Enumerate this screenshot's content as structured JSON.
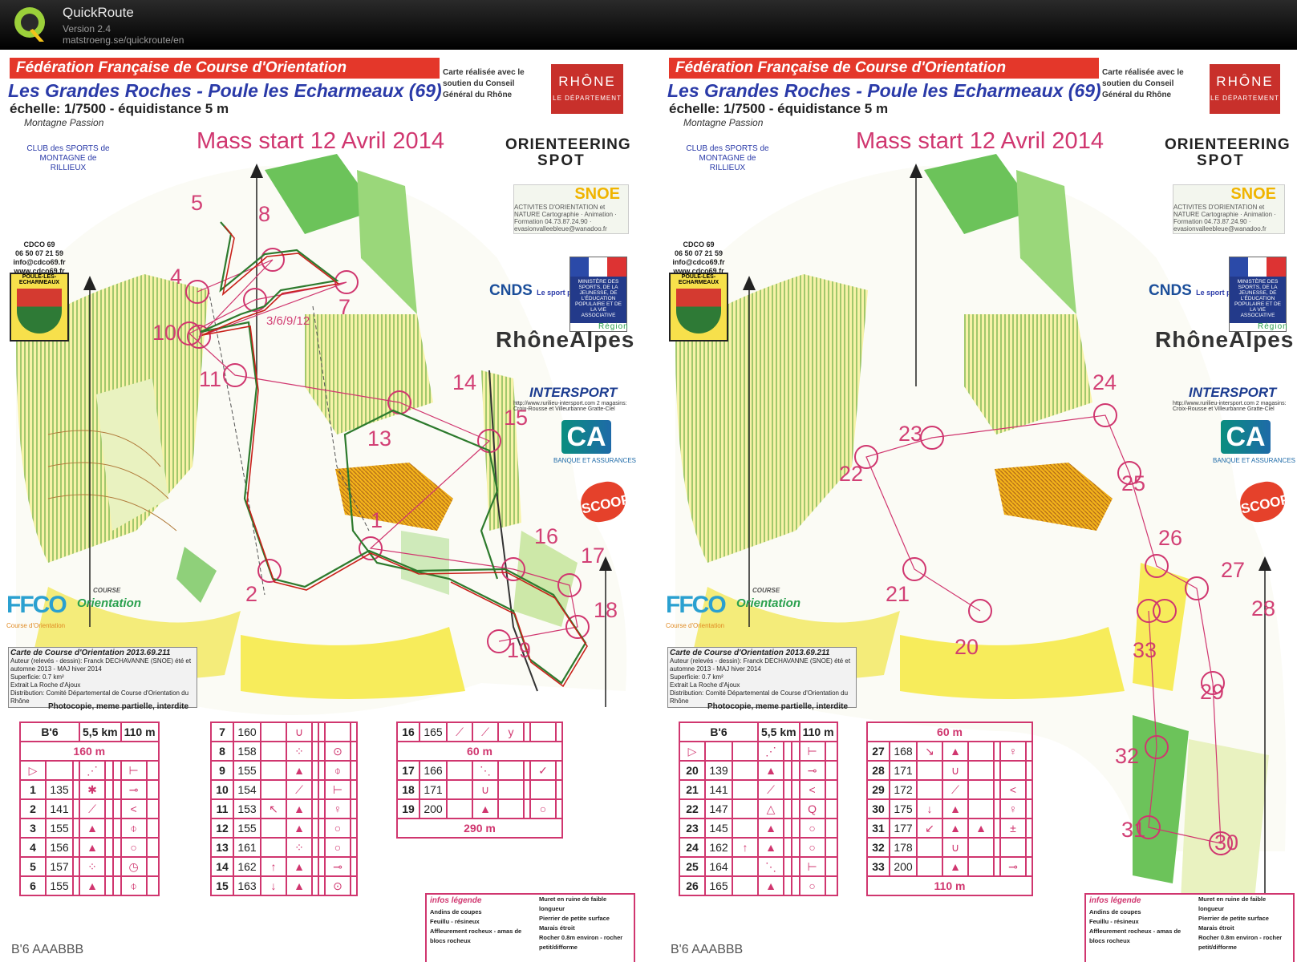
{
  "app": {
    "title": "QuickRoute",
    "version": "Version 2.4",
    "url": "matstroeng.se/quickroute/en"
  },
  "map": {
    "federation": "Fédération Française de Course d'Orientation",
    "event_title": "Les Grandes Roches - Poule les Echarmeaux (69)",
    "scale": "échelle: 1/7500 - équidistance 5 m",
    "mass_start": "Mass start 12 Avril 2014",
    "conseil": "Carte réalisée avec le soutien du Conseil Général du Rhône",
    "rhone": "RHÔNE",
    "rhone_sub": "LE DÉPARTEMENT",
    "montagne_passion": "Montagne Passion",
    "club": "CLUB des SPORTS de MONTAGNE de RILLIEUX",
    "orienteering_line1": "ORIENTEERING",
    "orienteering_line2": "SPOT",
    "snoe": "SNOE",
    "snoe_desc": "ACTIVITES D'ORIENTATION et NATURE Cartographie · Animation · Formation 04.73.87.24.90 · evasionvalleebleue@wanadoo.fr",
    "cdco": "CDCO 69\n06 50 07 21 59\ninfo@cdco69.fr\nwww.cdco69.fr",
    "poule_badge": "POULE-LES-ECHARMEAUX",
    "cnds": "CNDS",
    "cnds_sub": "Le sport pour tous",
    "ministere": "MINISTÈRE DES SPORTS, DE LA JEUNESSE, DE L'ÉDUCATION POPULAIRE ET DE LA VIE ASSOCIATIVE",
    "rhone_alpes": "RhôneAlpes",
    "region": "Région",
    "intersport": "INTERSPORT",
    "intersport_desc": "http://www.rurilieu-intersport.com 2 magasins: Croix-Rousse et Villeurbanne Gratte-Ciel",
    "credit_agricole": "CA",
    "credit_agricole_desc": "BANQUE ET ASSURANCES",
    "scoop": "SCOOP",
    "ffco": "FFCO",
    "ffco_sub": "Course d'Orientation",
    "course_orientation": "Orientation",
    "course_orientation_sub": "COURSE",
    "carte_title": "Carte de Course d'Orientation 2013.69.211",
    "carte_authors": "Auteur (relevés - dessin): Franck DECHAVANNE (SNOE) été et automne 2013 - MAJ hiver 2014",
    "carte_surface": "Superficie: 0.7 km²",
    "carte_extract": "Extrait La Roche d'Ajoux",
    "carte_distribution": "Distribution: Comité Départemental de Course d'Orientation du Rhône",
    "photocopie": "Photocopie, meme partielle, interdite",
    "infos_legende": "infos légende",
    "legend_items": [
      "Andins de coupes",
      "Feuillu - résineux",
      "Affleurement rocheux - amas de blocs rocheux",
      "Muret en ruine de faible longueur",
      "Pierrier de petite surface",
      "Marais étroit",
      "Rocher 0.8m environ - rocher petit/difforme"
    ],
    "footer": "B'6   AAABBB"
  },
  "left_controls": [
    {
      "label": "5"
    },
    {
      "label": "8"
    },
    {
      "label": "4"
    },
    {
      "label": "7"
    },
    {
      "label": "3/6/9/12"
    },
    {
      "label": "10"
    },
    {
      "label": "11"
    },
    {
      "label": "14"
    },
    {
      "label": "15"
    },
    {
      "label": "13"
    },
    {
      "label": "1"
    },
    {
      "label": "16"
    },
    {
      "label": "17"
    },
    {
      "label": "2"
    },
    {
      "label": "18"
    },
    {
      "label": "19"
    }
  ],
  "right_controls": [
    {
      "label": "24"
    },
    {
      "label": "23"
    },
    {
      "label": "22"
    },
    {
      "label": "25"
    },
    {
      "label": "26"
    },
    {
      "label": "27"
    },
    {
      "label": "21"
    },
    {
      "label": "28"
    },
    {
      "label": "20"
    },
    {
      "label": "33"
    },
    {
      "label": "29"
    },
    {
      "label": "32"
    },
    {
      "label": "31"
    },
    {
      "label": "30"
    }
  ],
  "cd_header": {
    "course": "B'6",
    "length": "5,5 km",
    "climb": "110 m",
    "start_leg": "160 m"
  },
  "cd_left_a": [
    {
      "n": "1",
      "code": "135"
    },
    {
      "n": "2",
      "code": "141"
    },
    {
      "n": "3",
      "code": "155"
    },
    {
      "n": "4",
      "code": "156"
    },
    {
      "n": "5",
      "code": "157"
    },
    {
      "n": "6",
      "code": "155"
    }
  ],
  "cd_left_b": [
    {
      "n": "7",
      "code": "160"
    },
    {
      "n": "8",
      "code": "158"
    },
    {
      "n": "9",
      "code": "155"
    },
    {
      "n": "10",
      "code": "154"
    },
    {
      "n": "11",
      "code": "153"
    },
    {
      "n": "12",
      "code": "155"
    },
    {
      "n": "13",
      "code": "161"
    },
    {
      "n": "14",
      "code": "162"
    },
    {
      "n": "15",
      "code": "163"
    }
  ],
  "cd_left_c": [
    {
      "n": "16",
      "code": "165"
    },
    {
      "n": "60m",
      "code": "60 m"
    },
    {
      "n": "17",
      "code": "166"
    },
    {
      "n": "18",
      "code": "171"
    },
    {
      "n": "19",
      "code": "200"
    },
    {
      "n": "290",
      "code": "290 m"
    }
  ],
  "cd_right_header": {
    "course": "B'6",
    "length": "5,5 km",
    "climb": "110 m",
    "leg": "60 m"
  },
  "cd_right_a": [
    {
      "n": "20",
      "code": "139"
    },
    {
      "n": "21",
      "code": "141"
    },
    {
      "n": "22",
      "code": "147"
    },
    {
      "n": "23",
      "code": "145"
    },
    {
      "n": "24",
      "code": "162"
    },
    {
      "n": "25",
      "code": "164"
    },
    {
      "n": "26",
      "code": "165"
    }
  ],
  "cd_right_b": [
    {
      "n": "27",
      "code": "168"
    },
    {
      "n": "28",
      "code": "171"
    },
    {
      "n": "29",
      "code": "172"
    },
    {
      "n": "30",
      "code": "175"
    },
    {
      "n": "31",
      "code": "177"
    },
    {
      "n": "32",
      "code": "178"
    },
    {
      "n": "33",
      "code": "200"
    }
  ],
  "cd_right_finish": "110 m",
  "colors": {
    "overprint": "#d0366f",
    "route_red": "#c8201a",
    "route_green": "#2d7a2d",
    "yellow": "#f2e86a",
    "forest_green": "#7ec86a"
  }
}
